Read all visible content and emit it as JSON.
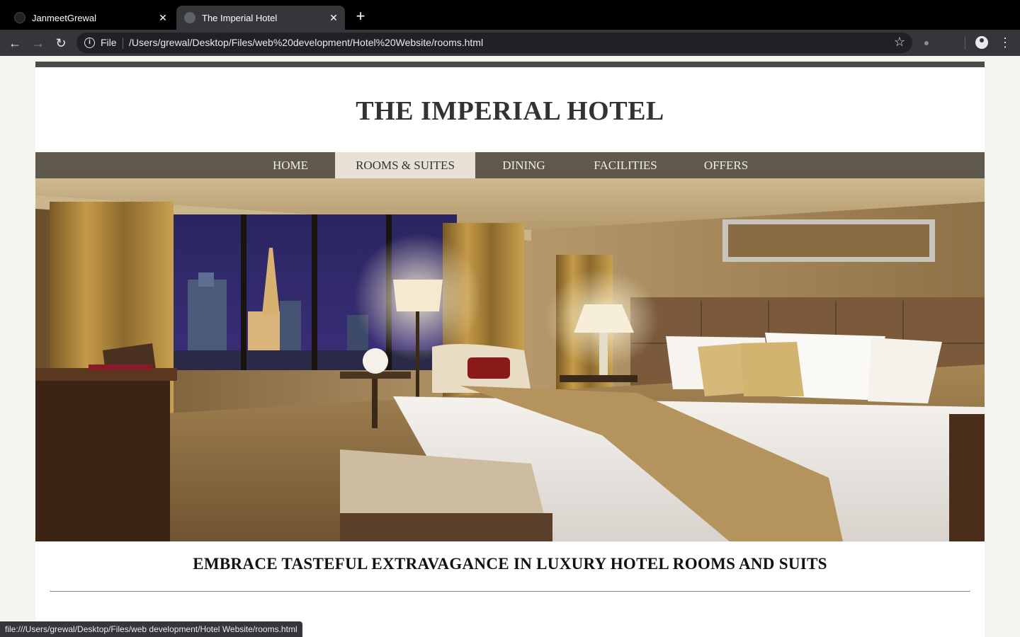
{
  "browser": {
    "tabs": [
      {
        "title": "JanmeetGrewal",
        "close": "✕"
      },
      {
        "title": "The Imperial Hotel",
        "close": "✕"
      }
    ],
    "new_tab": "+",
    "omnibox": {
      "scheme_label": "File",
      "url": "/Users/grewal/Desktop/Files/web%20development/Hotel%20Website/rooms.html"
    },
    "status_url": "file:///Users/grewal/Desktop/Files/web development/Hotel Website/rooms.html"
  },
  "site": {
    "brand": "THE IMPERIAL HOTEL",
    "nav": [
      {
        "label": "HOME",
        "active": false
      },
      {
        "label": "ROOMS & SUITES",
        "active": true
      },
      {
        "label": "DINING",
        "active": false
      },
      {
        "label": "FACILITIES",
        "active": false
      },
      {
        "label": "OFFERS",
        "active": false
      }
    ],
    "tagline": "EMBRACE TASTEFUL EXTRAVAGANCE IN LUXURY HOTEL ROOMS AND SUITS"
  },
  "colors": {
    "chrome_dark": "#35363a",
    "nav_bar": "#46423c",
    "nav_active": "#e8e2d6",
    "brand_text": "#333333"
  },
  "icons": [
    "back-arrow-icon",
    "forward-arrow-icon",
    "reload-icon",
    "info-icon",
    "star-icon",
    "extension-icon",
    "profile-icon",
    "menu-dots-icon",
    "github-icon",
    "globe-icon"
  ]
}
